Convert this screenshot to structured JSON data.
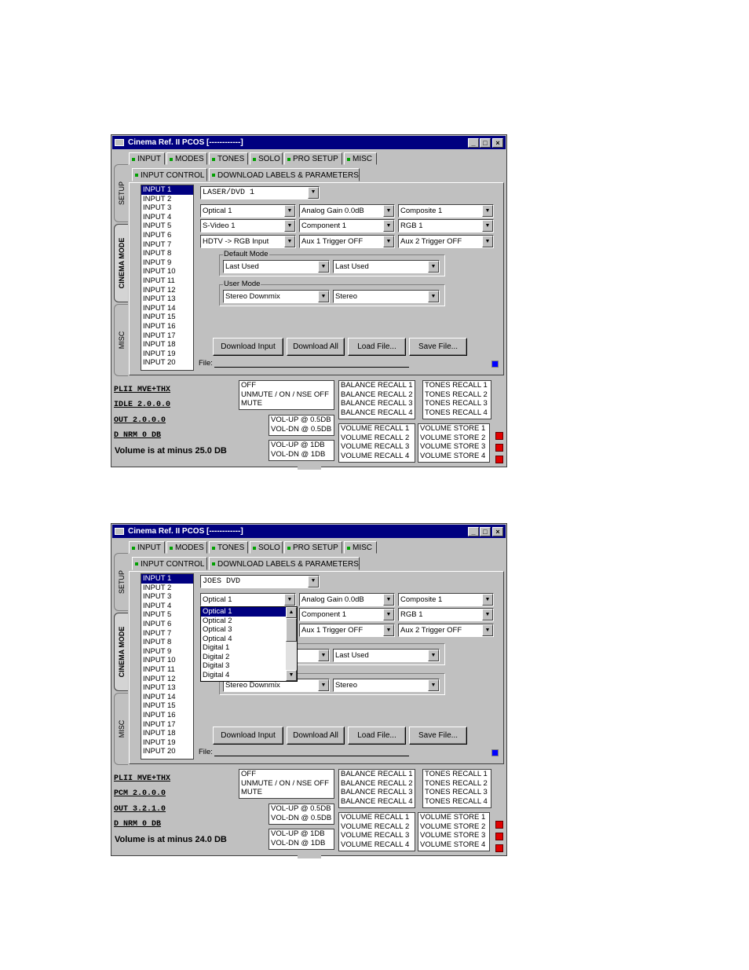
{
  "title": "Cinema Ref. II PCOS [------------]",
  "title_buttons": {
    "minimize": "_",
    "maximize": "□",
    "close": "×"
  },
  "side_tabs": [
    "SETUP",
    "CINEMA MODE",
    "MISC"
  ],
  "top_tabs": [
    "INPUT",
    "MODES",
    "TONES",
    "SOLO",
    "PRO SETUP",
    "MISC"
  ],
  "sub_tabs": [
    "INPUT CONTROL",
    "DOWNLOAD LABELS & PARAMETERS"
  ],
  "inputs": [
    "INPUT 1",
    "INPUT 2",
    "INPUT 3",
    "INPUT 4",
    "INPUT 5",
    "INPUT 6",
    "INPUT 7",
    "INPUT 8",
    "INPUT 9",
    "INPUT 10",
    "INPUT 11",
    "INPUT 12",
    "INPUT 13",
    "INPUT 14",
    "INPUT 15",
    "INPUT 16",
    "INPUT 17",
    "INPUT 18",
    "INPUT 19",
    "INPUT 20"
  ],
  "default_mode_label": "Default Mode",
  "user_mode_label": "User Mode",
  "buttons": {
    "download_input": "Download Input",
    "download_all": "Download All",
    "load_file": "Load File...",
    "save_file": "Save File..."
  },
  "file_label": "File:",
  "mute_options": [
    "OFF",
    "UNMUTE / ON / NSE OFF",
    "MUTE"
  ],
  "vol_05": [
    "VOL-UP @ 0.5DB",
    "VOL-DN @ 0.5DB"
  ],
  "vol_1": [
    "VOL-UP @ 1DB",
    "VOL-DN @ 1DB"
  ],
  "balance_recall": [
    "BALANCE RECALL 1",
    "BALANCE RECALL 2",
    "BALANCE RECALL 3",
    "BALANCE RECALL 4"
  ],
  "tones_recall": [
    "TONES RECALL 1",
    "TONES RECALL 2",
    "TONES RECALL 3",
    "TONES RECALL 4"
  ],
  "volume_recall": [
    "VOLUME RECALL 1",
    "VOLUME RECALL 2",
    "VOLUME RECALL 3",
    "VOLUME RECALL 4"
  ],
  "volume_store": [
    "VOLUME STORE 1",
    "VOLUME STORE 2",
    "VOLUME STORE 3",
    "VOLUME STORE 4"
  ],
  "window1": {
    "label": "LASER/DVD   1",
    "row1": [
      "Optical 1",
      "Analog Gain 0.0dB",
      "Composite 1"
    ],
    "row2": [
      "S-Video 1",
      "Component 1",
      "RGB 1"
    ],
    "row3": [
      "HDTV -> RGB Input",
      "Aux 1 Trigger OFF",
      "Aux 2 Trigger OFF"
    ],
    "default_mode": [
      "Last Used",
      "Last Used"
    ],
    "user_mode": [
      "Stereo Downmix",
      "Stereo"
    ],
    "status": [
      "PLII MVE+THX",
      "IDLE 2.0.0.0",
      "OUT  2.0.0.0",
      "D NRM   0 DB"
    ],
    "volume_msg": "Volume is at minus 25.0 DB"
  },
  "window2": {
    "label": "JOES DVD",
    "row1": [
      "Optical 1",
      "Analog Gain 0.0dB",
      "Composite 1"
    ],
    "row2": [
      "Component 1",
      "RGB 1"
    ],
    "row3": [
      "Aux 1 Trigger OFF",
      "Aux 2 Trigger OFF"
    ],
    "default_mode": [
      "Last Used"
    ],
    "user_mode": [
      "Stereo Downmix",
      "Stereo"
    ],
    "dropdown": [
      "Optical 1",
      "Optical 2",
      "Optical 3",
      "Optical 4",
      "Digital 1",
      "Digital 2",
      "Digital 3",
      "Digital 4"
    ],
    "status": [
      "PLII MVE+THX",
      "PCM  2.0.0.0",
      "OUT  3.2.1.0",
      "D NRM   0 DB"
    ],
    "volume_msg": "Volume is at minus 24.0 DB"
  },
  "colors": {
    "titlebar": "#000080",
    "face": "#c0c0c0",
    "selection": "#000080",
    "indicator_green": "#00a000",
    "red_button": "#e00000",
    "blue_button": "#0000ff"
  }
}
